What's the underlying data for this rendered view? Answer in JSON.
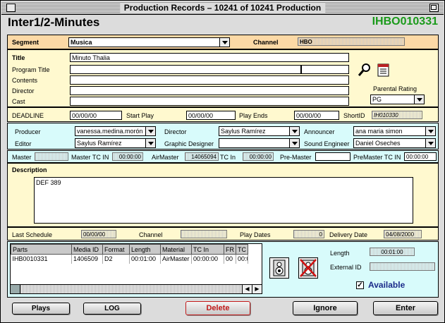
{
  "window": {
    "title": "Production Records – 10241 of 10241 Production",
    "heading": "Inter1/2-Minutes",
    "record_id": "IHBO010331"
  },
  "segment": {
    "segment_label": "Segment",
    "segment_value": "Musica",
    "channel_label": "Channel",
    "channel_value": "HBO"
  },
  "titles": {
    "title_label": "Title",
    "title_value": "Minuto Thalia",
    "program_title_label": "Program Title",
    "contents_label": "Contents",
    "director_label": "Director",
    "cast_label": "Cast",
    "parental_rating_label": "Parental Rating",
    "parental_rating_value": "PG"
  },
  "deadline": {
    "deadline_label": "DEADLINE",
    "deadline_value": "00/00/00",
    "start_play_label": "Start Play",
    "start_play_value": "00/00/00",
    "play_ends_label": "Play Ends",
    "play_ends_value": "00/00/00",
    "short_id_label": "ShortID",
    "short_id_value": "IH010330"
  },
  "crew": {
    "producer_label": "Producer",
    "producer_value": "vanessa.medina.morón",
    "director_label": "Director",
    "director_value": "Saylus Ramírez",
    "announcer_label": "Announcer",
    "announcer_value": "ana maria simon",
    "editor_label": "Editor",
    "editor_value": "Saylus Ramírez",
    "graphic_designer_label": "Graphic Designer",
    "graphic_designer_value": "",
    "sound_engineer_label": "Sound Engineer",
    "sound_engineer_value": "Daniel Oseches"
  },
  "masters": {
    "master_label": "Master",
    "master_value": "",
    "master_tc_in_label": "Master TC IN",
    "master_tc_in_value": "00:00:00",
    "air_master_label": "AirMaster",
    "air_master_value": "14065094",
    "tc_in_label": "TC In",
    "tc_in_value": "00:00:00",
    "pre_master_label": "Pre-Master",
    "pre_master_value": "",
    "premaster_tc_in_label": "PreMaster TC IN",
    "premaster_tc_in_value": "00:00:00"
  },
  "description": {
    "label": "Description",
    "value": "DEF 389"
  },
  "schedule": {
    "last_schedule_label": "Last Schedule",
    "last_schedule_value": "00/00/00",
    "channel_label": "Channel",
    "channel_value": "",
    "play_dates_label": "Play Dates",
    "play_dates_value": "0",
    "delivery_date_label": "Delivery Date",
    "delivery_date_value": "04/08/2000"
  },
  "parts": {
    "columns": [
      "Parts",
      "Media ID",
      "Format",
      "Length",
      "Material",
      "TC In",
      "FR",
      "TC"
    ],
    "rows": [
      [
        "IHB0010331",
        "1406509",
        "D2",
        "00:01:00",
        "AirMaster",
        "00:00:00",
        "00",
        "00:0"
      ]
    ],
    "length_label": "Length",
    "length_value": "00:01:00",
    "external_id_label": "External ID",
    "external_id_value": "",
    "available_label": "Available",
    "available_checked": true
  },
  "buttons": {
    "plays": "Plays",
    "log": "LOG",
    "delete": "Delete",
    "ignore": "Ignore",
    "enter": "Enter"
  },
  "colors": {
    "record_id": "#1a9a1a",
    "segment_panel": "#fcd9a6",
    "form_panel": "#fff9cf",
    "crew_panel": "#d8fbfb",
    "delete_text": "#c21a1a",
    "available_text": "#1a2a8a"
  },
  "icons": [
    "search-icon",
    "calendar-icon",
    "speaker-icon",
    "speaker-muted-icon",
    "close-box-icon",
    "zoom-box-icon"
  ]
}
